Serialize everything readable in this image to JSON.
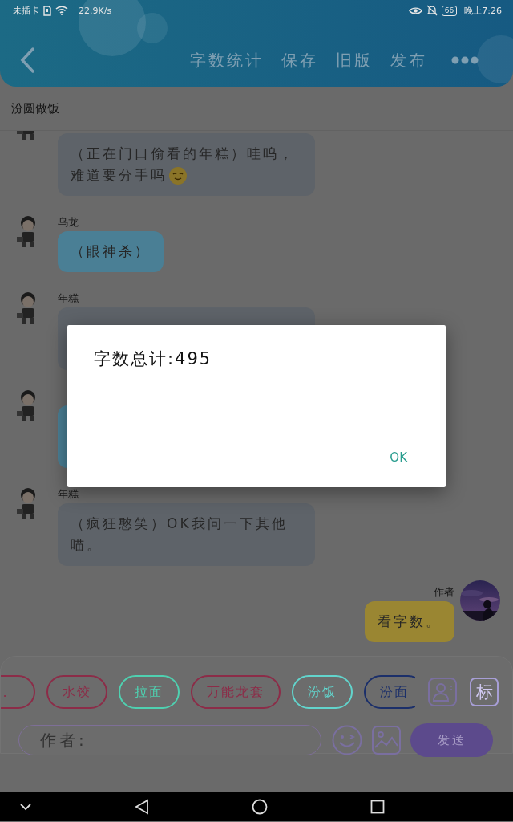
{
  "status_bar": {
    "carrier": "未插卡",
    "speed": "22.9K/s",
    "battery": "66",
    "time": "晚上7:26"
  },
  "header": {
    "actions": [
      "字数统计",
      "保存",
      "旧版",
      "发布"
    ]
  },
  "chat_title": "汾圆做饭",
  "messages": [
    {
      "kind": "incoming",
      "color": "#5e6369",
      "lines": [
        "（正在门口偷看的年糕）哇呜，",
        "难道要分手吗"
      ],
      "emoji": true
    },
    {
      "sender": "乌龙",
      "kind": "incoming",
      "color": "#4a7f95",
      "lines": [
        "（眼神杀）"
      ]
    },
    {
      "sender": "年糕",
      "kind": "incoming",
      "color": "#5e6369"
    },
    {
      "kind": "incoming",
      "color": "#4a7f95"
    },
    {
      "sender": "年糕",
      "kind": "incoming",
      "color": "#5e6369",
      "lines": [
        "（疯狂憨笑）OK我问一下其他",
        "喵。"
      ]
    },
    {
      "sender": "作者",
      "kind": "outgoing",
      "color": "#9a8632",
      "lines": [
        "看字数。"
      ]
    }
  ],
  "input_panel": {
    "chips": [
      {
        "label": ".",
        "color": "#8c2c48"
      },
      {
        "label": "水饺",
        "color": "#8c2c48"
      },
      {
        "label": "拉面",
        "color": "#4fd0b0"
      },
      {
        "label": "万能龙套",
        "color": "#8c2c48"
      },
      {
        "label": "汾饭",
        "color": "#62d4cc"
      },
      {
        "label": "汾面",
        "color": "#1b2f6a"
      }
    ],
    "tag_button": "标",
    "placeholder": "作者:",
    "send": "发送"
  },
  "dialog": {
    "message": "字数总计:495",
    "button": "OK"
  }
}
